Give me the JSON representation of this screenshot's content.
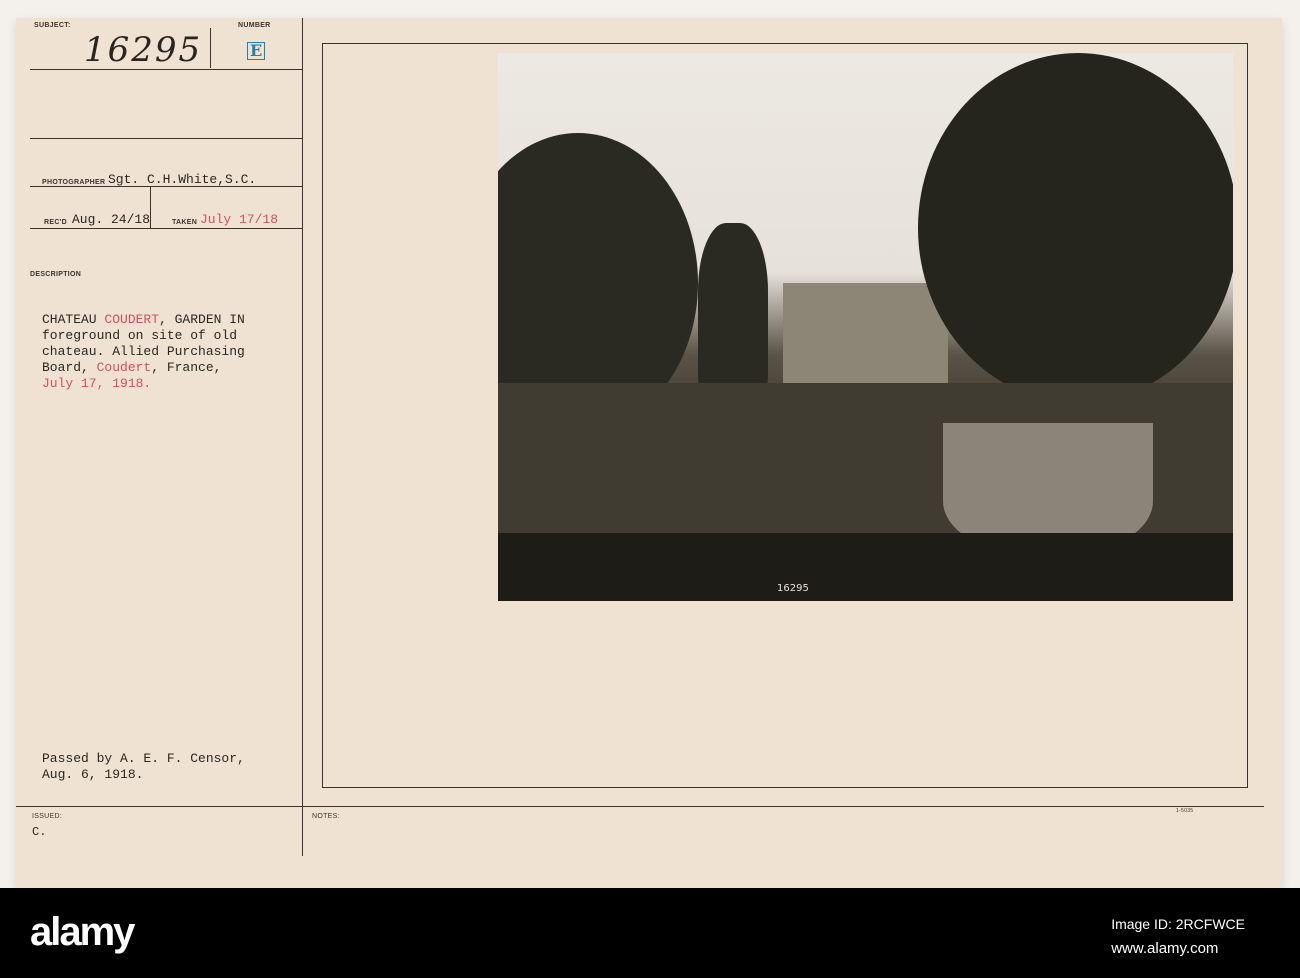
{
  "card": {
    "subject_label": "SUBJECT:",
    "subject_value": "16295",
    "number_label": "NUMBER",
    "number_value": "E",
    "photographer_label": "PHOTOGRAPHER",
    "photographer_value": "Sgt. C.H.White,S.C.",
    "recd_label": "REC'D",
    "recd_value": "Aug. 24/18",
    "taken_label": "TAKEN",
    "taken_value": "July 17/18",
    "description_label": "DESCRIPTION",
    "description_lines": [
      [
        "CHATEAU ",
        "COUDERT",
        ", GARDEN IN"
      ],
      [
        "foreground on site of old"
      ],
      [
        "chateau. Allied Purchasing"
      ],
      [
        "Board, ",
        "Coudert",
        ", France,"
      ],
      [
        "July 17, 1918."
      ]
    ],
    "censor_lines": [
      "Passed by A. E. F. Censor,",
      "Aug. 6, 1918."
    ],
    "issued_label": "ISSUED:",
    "issued_value": "C.",
    "notes_label": "NOTES:",
    "form_number": "1-5035",
    "photo_number": "16295"
  },
  "footer": {
    "logo": "alamy",
    "image_id": "Image ID: 2RCFWCE",
    "url": "www.alamy.com"
  }
}
